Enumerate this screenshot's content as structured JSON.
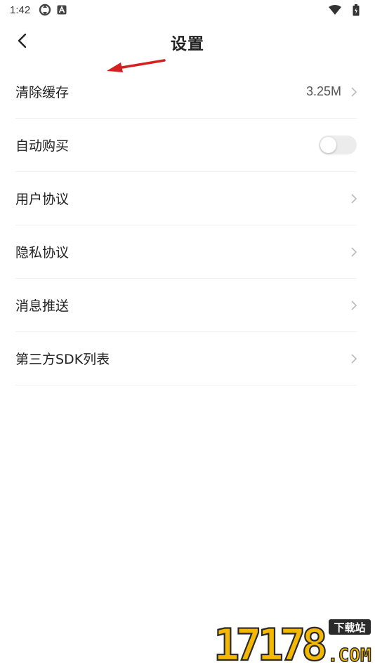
{
  "status_bar": {
    "time": "1:42",
    "icons": [
      "sync-icon",
      "a-icon",
      "wifi-icon",
      "battery-icon"
    ]
  },
  "header": {
    "title": "设置",
    "back_icon": "back-chevron-icon"
  },
  "settings": [
    {
      "label": "清除缓存",
      "value": "3.25M",
      "control": "chevron"
    },
    {
      "label": "自动购买",
      "control": "toggle",
      "toggle_on": false
    },
    {
      "label": "用户协议",
      "control": "chevron"
    },
    {
      "label": "隐私协议",
      "control": "chevron"
    },
    {
      "label": "消息推送",
      "control": "chevron"
    },
    {
      "label": "第三方SDK列表",
      "control": "chevron"
    }
  ],
  "annotation": {
    "icon": "red-arrow-icon",
    "color": "#d42020"
  },
  "watermark": {
    "text": "17178.COM",
    "badge": "下载站"
  },
  "colors": {
    "background": "#ffffff",
    "text": "#222222",
    "divider": "#f0f0f0",
    "toggle_off": "#ececec",
    "chevron": "#bbbbbb",
    "watermark_yellow": "#f5b800"
  }
}
